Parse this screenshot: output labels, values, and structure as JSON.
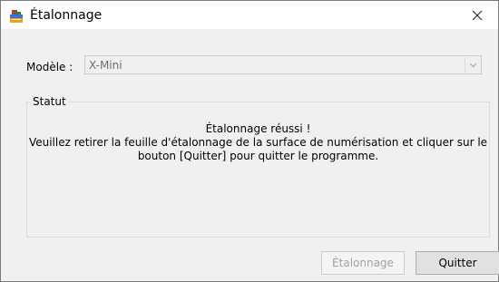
{
  "window": {
    "title": "Étalonnage",
    "icon": "app-icon",
    "close_icon": "close-icon"
  },
  "model": {
    "label": "Modèle :",
    "selected": "X-Mini",
    "disabled": true
  },
  "status": {
    "group_title": "Statut",
    "line1": "Étalonnage réussi !",
    "line2": "Veuillez retirer la feuille d'étalonnage de la surface de numérisation et cliquer sur le",
    "line3": "bouton [Quitter] pour quitter le programme."
  },
  "buttons": {
    "calibrate_label": "Étalonnage",
    "calibrate_disabled": true,
    "quit_label": "Quitter"
  }
}
